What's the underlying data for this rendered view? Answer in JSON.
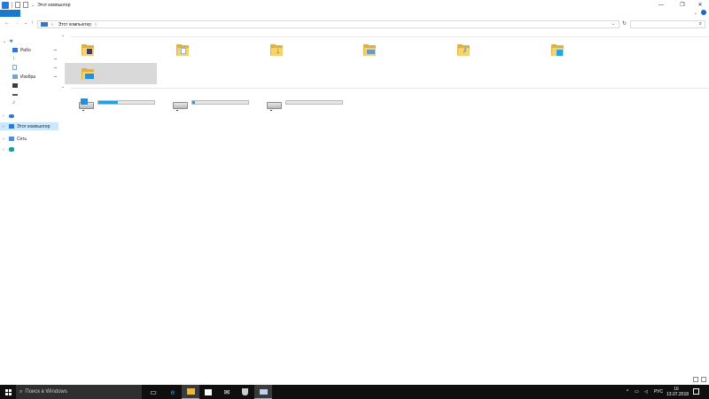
{
  "window": {
    "title": "Этот компьютер"
  },
  "window_controls": {
    "minimize": "—",
    "maximize": "❐",
    "close": "✕",
    "caret": "⌄",
    "help": "?"
  },
  "address": {
    "path": "Этот компьютер",
    "separator": "›"
  },
  "nav_buttons": {
    "back": "←",
    "forward": "→",
    "recent": "⌄",
    "up": "↑",
    "refresh": "↻"
  },
  "search": {
    "icon": "search-icon",
    "glyph": "⌕"
  },
  "nav_pane": {
    "items": [
      {
        "label": "",
        "icon": "star-quick-access-icon",
        "expanded": true
      },
      {
        "label": "Рабо",
        "icon": "desktop-icon",
        "pinned": true
      },
      {
        "label": "",
        "icon": "downloads-icon",
        "pinned": true
      },
      {
        "label": "",
        "icon": "documents-icon",
        "pinned": true
      },
      {
        "label": "Изобра",
        "icon": "pictures-icon",
        "pinned": true
      },
      {
        "label": "",
        "icon": "video-icon"
      },
      {
        "label": "",
        "icon": "usb-drive-icon"
      },
      {
        "label": "",
        "icon": "music-icon"
      },
      {
        "label": "",
        "icon": "onedrive-icon"
      },
      {
        "label": "Этот компьютер",
        "icon": "this-pc-icon",
        "selected": true
      },
      {
        "label": "Сеть",
        "icon": "network-icon"
      },
      {
        "label": "",
        "icon": "homegroup-icon"
      }
    ],
    "pin_glyph": "📌"
  },
  "folders": [
    {
      "name": "video-folder",
      "overlay": "film-icon"
    },
    {
      "name": "documents-folder",
      "overlay": "document-icon"
    },
    {
      "name": "downloads-folder",
      "overlay": "download-arrow-icon"
    },
    {
      "name": "pictures-folder",
      "overlay": "picture-icon"
    },
    {
      "name": "music-folder",
      "overlay": "music-note-icon"
    },
    {
      "name": "3d-objects-folder",
      "overlay": "cube-icon"
    },
    {
      "name": "desktop-folder",
      "overlay": "desktop-screen-icon",
      "selected": true
    }
  ],
  "drives": [
    {
      "name": "system-drive",
      "used_fraction": 0.35,
      "system": true
    },
    {
      "name": "drive-2",
      "used_fraction": 0.04
    },
    {
      "name": "drive-3",
      "used_fraction": 0.0
    }
  ],
  "taskbar": {
    "search_placeholder": "Поиск в Windows",
    "search_glyph": "⌕",
    "icons": [
      "task-view-icon",
      "edge-icon",
      "file-explorer-icon",
      "store-icon",
      "mail-icon",
      "security-icon",
      "app-icon"
    ],
    "tray": {
      "language": "РУС",
      "time": "16",
      "date": "13.07.2018",
      "chevron": "^"
    }
  }
}
